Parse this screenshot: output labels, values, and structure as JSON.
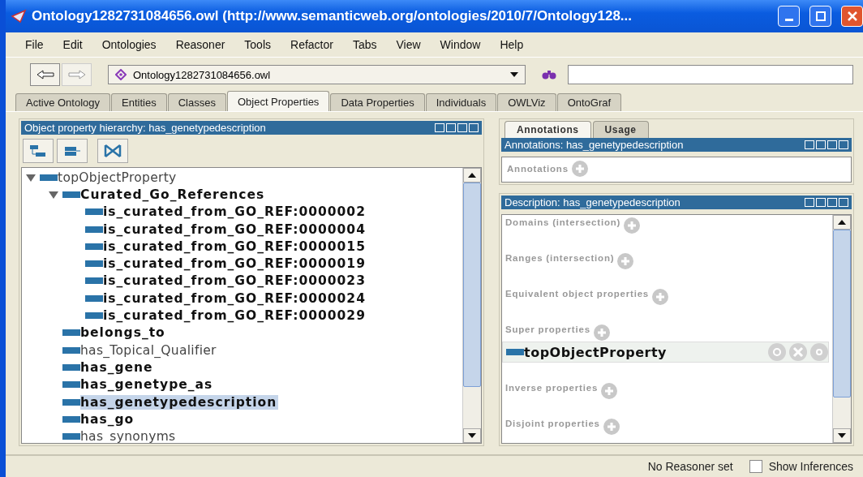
{
  "window": {
    "title": "Ontology1282731084656.owl (http://www.semanticweb.org/ontologies/2010/7/Ontology128..."
  },
  "menu": [
    "File",
    "Edit",
    "Ontologies",
    "Reasoner",
    "Tools",
    "Refactor",
    "Tabs",
    "View",
    "Window",
    "Help"
  ],
  "toolbar": {
    "ontology": "Ontology1282731084656.owl"
  },
  "tabs": [
    {
      "label": "Active Ontology",
      "selected": false
    },
    {
      "label": "Entities",
      "selected": false
    },
    {
      "label": "Classes",
      "selected": false
    },
    {
      "label": "Object Properties",
      "selected": true
    },
    {
      "label": "Data Properties",
      "selected": false
    },
    {
      "label": "Individuals",
      "selected": false
    },
    {
      "label": "OWLViz",
      "selected": false
    },
    {
      "label": "OntoGraf",
      "selected": false
    }
  ],
  "hierarchy": {
    "title": "Object property hierarchy: has_genetypedescription",
    "tree": [
      {
        "label": "topObjectProperty",
        "bold": false,
        "selected": false,
        "expanded": true,
        "children": [
          {
            "label": "Curated_Go_References",
            "bold": true,
            "selected": false,
            "expanded": true,
            "children": [
              {
                "label": "is_curated_from_GO_REF:0000002",
                "bold": true,
                "selected": false
              },
              {
                "label": "is_curated_from_GO_REF:0000004",
                "bold": true,
                "selected": false
              },
              {
                "label": "is_curated_from_GO_REF:0000015",
                "bold": true,
                "selected": false
              },
              {
                "label": "is_curated_from_GO_REF:0000019",
                "bold": true,
                "selected": false
              },
              {
                "label": "is_curated_from_GO_REF:0000023",
                "bold": true,
                "selected": false
              },
              {
                "label": "is_curated_from_GO_REF:0000024",
                "bold": true,
                "selected": false
              },
              {
                "label": "is_curated_from_GO_REF:0000029",
                "bold": true,
                "selected": false
              }
            ]
          },
          {
            "label": "belongs_to",
            "bold": true,
            "selected": false
          },
          {
            "label": "has_Topical_Qualifier",
            "bold": false,
            "selected": false
          },
          {
            "label": "has_gene",
            "bold": true,
            "selected": false
          },
          {
            "label": "has_genetype_as",
            "bold": true,
            "selected": false
          },
          {
            "label": "has_genetypedescription",
            "bold": true,
            "selected": true
          },
          {
            "label": "has_go",
            "bold": true,
            "selected": false
          },
          {
            "label": "has_synonyms",
            "bold": false,
            "selected": false
          }
        ]
      }
    ]
  },
  "side_tabs": [
    {
      "label": "Annotations",
      "selected": true
    },
    {
      "label": "Usage",
      "selected": false
    }
  ],
  "annotations": {
    "title": "Annotations: has_genetypedescription",
    "sections": [
      {
        "label": "Annotations"
      }
    ]
  },
  "description": {
    "title": "Description: has_genetypedescription",
    "sections": [
      {
        "label": "Domains (intersection)"
      },
      {
        "label": "Ranges (intersection)"
      },
      {
        "label": "Equivalent object properties"
      },
      {
        "label": "Super properties",
        "items": [
          {
            "label": "topObjectProperty"
          }
        ]
      },
      {
        "label": "Inverse properties"
      },
      {
        "label": "Disjoint properties"
      }
    ]
  },
  "status": {
    "reasoner": "No Reasoner set",
    "show_inferences": {
      "label": "Show Inferences",
      "checked": false
    }
  }
}
